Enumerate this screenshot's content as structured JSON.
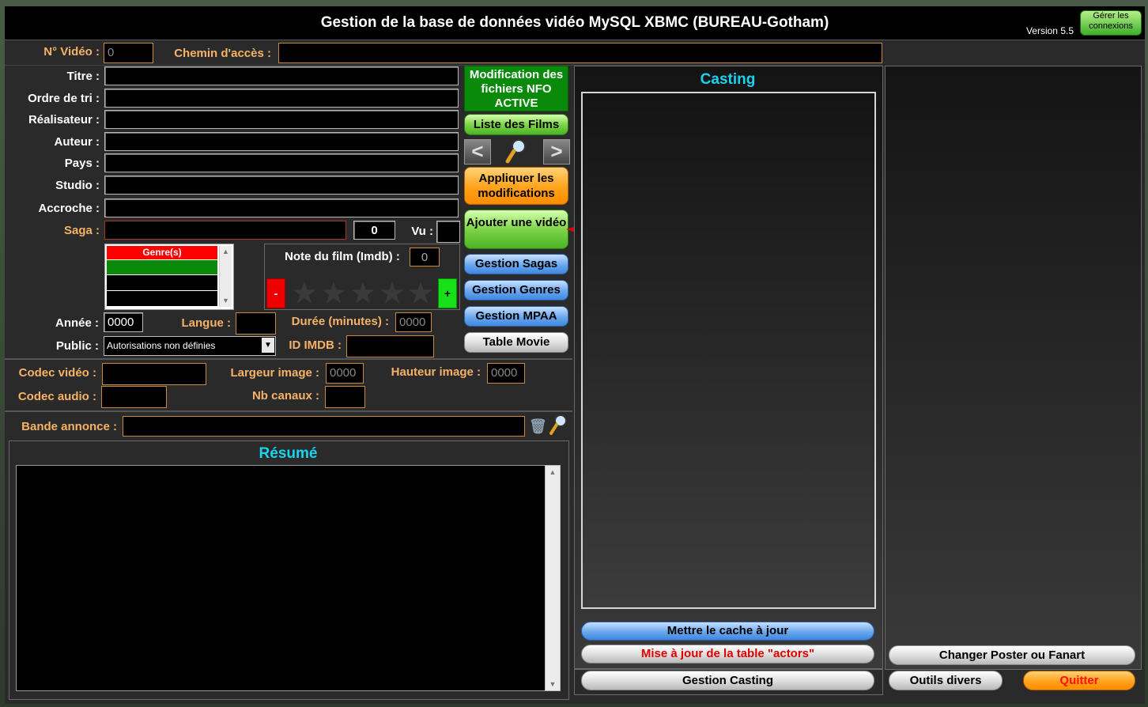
{
  "window": {
    "title": "Gestion de la base de données vidéo MySQL XBMC (BUREAU-Gotham)",
    "version": "Version 5.5",
    "connections_button": "Gérer les connexions"
  },
  "video": {
    "num_label": "N° Vidéo :",
    "num_value": "0",
    "path_label": "Chemin d'accès :",
    "path_value": ""
  },
  "fields": [
    {
      "label": "Titre :",
      "value": ""
    },
    {
      "label": "Ordre de tri :",
      "value": ""
    },
    {
      "label": "Réalisateur :",
      "value": ""
    },
    {
      "label": "Auteur :",
      "value": ""
    },
    {
      "label": "Pays :",
      "value": ""
    },
    {
      "label": "Studio :",
      "value": ""
    },
    {
      "label": "Accroche :",
      "value": ""
    }
  ],
  "saga": {
    "label": "Saga :",
    "value": "",
    "count": "0",
    "vu_label": "Vu :"
  },
  "genres": {
    "header": "Genre(s)"
  },
  "rating": {
    "label": "Note du film (Imdb) :",
    "value": "0",
    "minus": "-",
    "plus": "+",
    "stars": 0,
    "max_stars": 5
  },
  "annee": {
    "label": "Année :",
    "value": "0000"
  },
  "langue": {
    "label": "Langue :",
    "value": ""
  },
  "duree": {
    "label": "Durée (minutes) :",
    "value": "0000"
  },
  "public": {
    "label": "Public :",
    "value": "Autorisations non définies"
  },
  "imdb_id": {
    "label": "ID IMDB :",
    "value": ""
  },
  "codec": {
    "video_label": "Codec vidéo :",
    "video_value": "",
    "audio_label": "Codec audio :",
    "audio_value": "",
    "largeur_label": "Largeur image :",
    "largeur_value": "0000",
    "hauteur_label": "Hauteur image :",
    "hauteur_value": "0000",
    "canaux_label": "Nb canaux :",
    "canaux_value": ""
  },
  "trailer": {
    "label": "Bande annonce :",
    "value": ""
  },
  "resume": {
    "title": "Résumé"
  },
  "actions": {
    "nfo": "Modification des fichiers NFO ACTIVE",
    "films": "Liste des Films",
    "apply": "Appliquer les modifications",
    "add": "Ajouter une vidéo",
    "sagas": "Gestion Sagas",
    "genres": "Gestion Genres",
    "mpaa": "Gestion MPAA",
    "table": "Table Movie"
  },
  "casting": {
    "title": "Casting",
    "cache_button": "Mettre le cache à jour",
    "actors_button": "Mise à jour de la table \"actors\"",
    "manage_button": "Gestion Casting"
  },
  "right": {
    "poster_button": "Changer Poster ou Fanart",
    "tools_button": "Outils divers",
    "quit_button": "Quitter"
  },
  "colors": {
    "accent_orange": "#f6b266",
    "cyan_title": "#19d3f0",
    "arrow_red": "#e00000",
    "actors_red": "#e00000",
    "quit_red": "#ff1010"
  }
}
